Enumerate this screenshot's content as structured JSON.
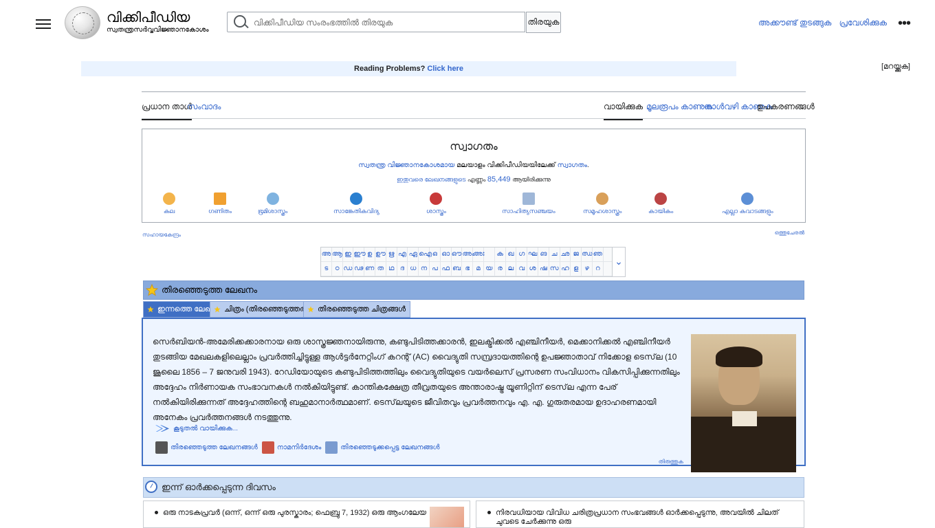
{
  "header": {
    "logo_title": "വിക്കിപീഡിയ",
    "logo_subtitle": "സ്വതന്ത്രസർവ്വവിജ്ഞാനകോശം",
    "search_placeholder": "വിക്കിപീഡിയ സംരംഭത്തിൽ തിരയുക",
    "search_button": "തിരയുക",
    "links": [
      "അക്കൗണ്ട് തുടങ്ങുക",
      "പ്രവേശിക്കുക"
    ]
  },
  "notice": {
    "text": "Reading Problems?",
    "link": "Click here",
    "hide": "[മറയ്ക്കുക]"
  },
  "tabs": {
    "left": [
      "പ്രധാന താൾ",
      "സംവാദം"
    ],
    "right": [
      "വായിക്കുക",
      "മൂലരൂപം കാണുക",
      "നാൾവഴി കാണുക",
      "ഉപകരണങ്ങൾ"
    ]
  },
  "portal": {
    "title": "സ്വാഗതം",
    "line1_link1": "സ്വതന്ത്ര വിജ്ഞാനകോശമായ",
    "line1_mid": "മലയാളം വിക്കിപീഡിയയിലേക്ക്",
    "line1_link2": "സ്വാഗതം",
    "line2_link": "ഇതുവരെ ലേഖനങ്ങളുടെ",
    "line2_mid": "എണ്ണം",
    "count": "85,449",
    "line2_end": "ആയിരിക്കുന്നു",
    "categories": [
      "കല",
      "ഗണിതം",
      "ഭൂമിശാസ്ത്രം",
      "സാങ്കേതികവിദ്യ",
      "ശാസ്ത്രം",
      "സാഹിത്യസഞ്ചയം",
      "സമൂഹശാസ്ത്രം",
      "കായികം",
      "എല്ലാ കവാടങ്ങളും"
    ],
    "sub_left": "സഹായകേന്ദ്രം",
    "sub_right": "ഒത്തുചേരൽ"
  },
  "alphabet": {
    "row1": [
      "അ",
      "ആ",
      "ഇ",
      "ഈ",
      "ഉ",
      "ഊ",
      "ഋ",
      "എ",
      "ഏ",
      "ഐ",
      "ഒ",
      "ഓ",
      "ഔ",
      "അം",
      "അഃ",
      "",
      "ക",
      "ഖ",
      "ഗ",
      "ഘ",
      "ങ",
      "ച",
      "ഛ",
      "ജ",
      "ഝ",
      "ഞ",
      ""
    ],
    "row2": [
      "ട",
      "ഠ",
      "ഡ",
      "ഢ",
      "ണ",
      "ത",
      "ഥ",
      "ദ",
      "ധ",
      "ന",
      "പ",
      "ഫ",
      "ബ",
      "ഭ",
      "മ",
      "യ",
      "ര",
      "ല",
      "വ",
      "ശ",
      "ഷ",
      "സ",
      "ഹ",
      "ള",
      "ഴ",
      "റ",
      ""
    ]
  },
  "featured": {
    "heading": "തിരഞ്ഞെടുത്ത ലേഖനം",
    "tabs": [
      "ഇന്നത്തെ ലേഖനം",
      "ചിത്രം (തിരഞ്ഞെടുത്തത്)",
      "തിരഞ്ഞെടുത്ത ചിത്രങ്ങൾ"
    ],
    "paragraph": "സെർബിയൻ-അമേരിക്കക്കാരനായ ഒരു ശാസ്ത്രജ്ഞനായിരുന്നു, കണ്ടുപിടിത്തക്കാരൻ, ഇലക്ട്രിക്കൽ എഞ്ചിനീയർ, മെക്കാനിക്കൽ എഞ്ചിനീയർ തുടങ്ങിയ മേഖലകളിലെല്ലാം പ്രവർത്തിച്ചിട്ടുള്ള ആൾട്ടർനേറ്റിംഗ് കറന്റ് (AC) വൈദ്യുതി സമ്പ്രദായത്തിന്റെ ഉപജ്ഞാതാവ് നിക്കോള ടെസ്‌ല (10 ജൂലൈ 1856 – 7 ജനുവരി 1943). റേഡിയോയുടെ കണ്ടുപിടിത്തത്തിലും വൈദ്യുതിയുടെ വയർലെസ് പ്രസരണ സംവിധാനം വികസിപ്പിക്കുന്നതിലും അദ്ദേഹം നിർണായക സംഭാവനകൾ നൽകിയിട്ടുണ്ട്. കാന്തികക്ഷേത്ര തീവ്രതയുടെ അന്താരാഷ്ട്ര യൂണിറ്റിന് ടെസ്‌ല എന്ന പേര് നൽകിയിരിക്കുന്നത് അദ്ദേഹത്തിന്റെ ബഹുമാനാർത്ഥമാണ്. ടെസ്‌ലയുടെ ജീവിതവും പ്രവർത്തനവും എ. എ. ഗുരുതരമായ ഉദാഹരണമായി അനേകം പ്രവർത്തനങ്ങൾ നടത്തുന്നു.",
    "more": "കൂടുതൽ വായിക്കുക...",
    "links": [
      "തിരഞ്ഞെടുത്ത ലേഖനങ്ങൾ",
      "നാമനിർദേശം",
      "തിരഞ്ഞെടുക്കപ്പെട്ട ലേഖനങ്ങൾ"
    ],
    "edit": "തിരുത്തുക"
  },
  "today": {
    "heading": "ഇന്ന് ഓർക്കപ്പെടുന്ന ദിവസം",
    "left": "ഒരു നാടകപ്രവർ (ഒന്ന്, ഒന്ന് ഒരു പുരസ്കാരം; ഫെബ്രു 7, 1932) ഒരു ആംഗലേയ",
    "right": "നിരവധിയായ വിവിധ ചരിത്രപ്രധാന സംഭവങ്ങൾ ഓർക്കപ്പെടുന്നു, അവയിൽ ചിലത് ചുവടെ ചേർക്കുന്നു ഒരു"
  },
  "colors": {
    "link": "#3366cc",
    "featured_head": "#88aadd",
    "featured_border": "#3f6fc4",
    "featured_bg": "#eef5ff"
  }
}
